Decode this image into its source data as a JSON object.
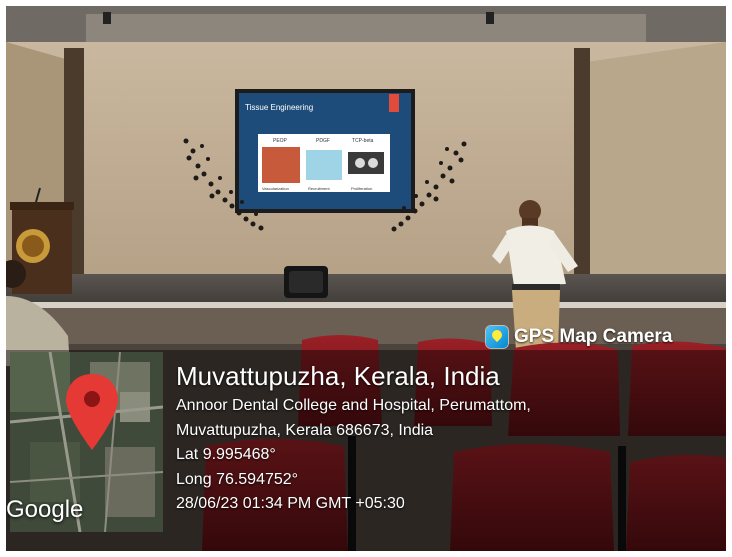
{
  "badge": {
    "icon": "map-pin-app-icon",
    "label": "GPS Map Camera"
  },
  "location": {
    "title": "Muvattupuzha, Kerala, India",
    "address_line_1": "Annoor Dental College and Hospital, Perumattom,",
    "address_line_2": "Muvattupuzha, Kerala 686673, India",
    "latitude": "Lat 9.995468°",
    "longitude": "Long 76.594752°",
    "datetime": "28/06/23 01:34 PM GMT +05:30"
  },
  "map": {
    "watermark": "Google",
    "pin_color": "#e53935"
  },
  "slide": {
    "title": "Tissue Engineering",
    "labels": [
      "PEOP",
      "PDGF",
      "TCP-beta"
    ],
    "captions": [
      "Vascularization",
      "Recruitment",
      "Proliferation"
    ]
  },
  "colors": {
    "chairs": "#8e1a1f",
    "overlay": "#000000"
  }
}
